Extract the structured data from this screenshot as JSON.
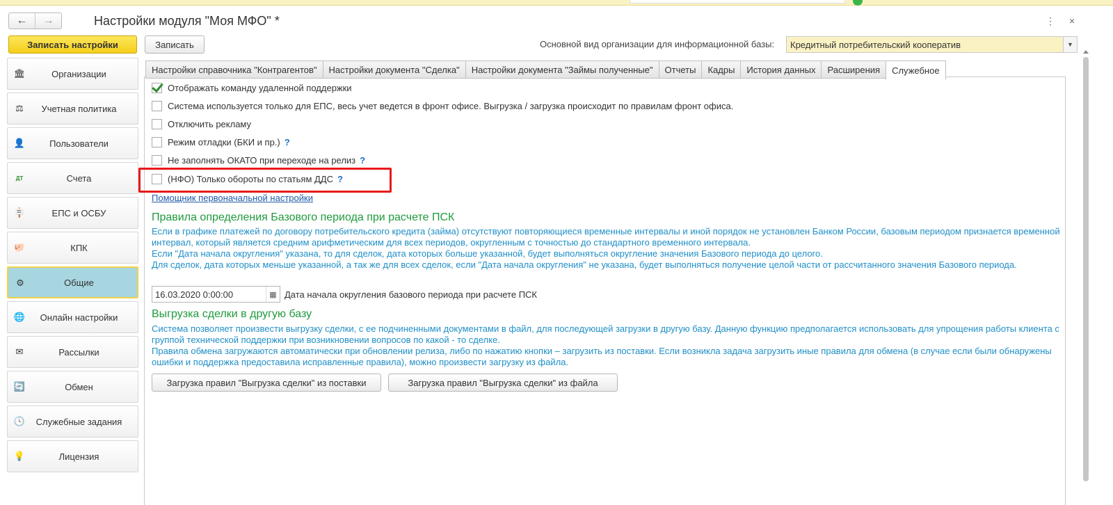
{
  "window": {
    "title": "Настройки модуля \"Моя МФО\" *",
    "back_icon": "←",
    "forward_icon": "→",
    "menu_icon": "⋮",
    "close_icon": "×"
  },
  "toolbar": {
    "save_settings_label": "Записать настройки",
    "save_label": "Записать",
    "org_type_label": "Основной вид организации для информационной базы:",
    "org_type_value": "Кредитный потребительский кооператив"
  },
  "sidebar": {
    "items": [
      {
        "label": "Организации",
        "icon": "🏛",
        "icon_name": "bank-icon"
      },
      {
        "label": "Учетная политика",
        "icon": "⚖",
        "icon_name": "scales-icon"
      },
      {
        "label": "Пользователи",
        "icon": "👤",
        "icon_name": "user-icon"
      },
      {
        "label": "Счета",
        "icon": "ДТ",
        "icon_name": "accounts-icon"
      },
      {
        "label": "ЕПС и ОСБУ",
        "icon": "🪧",
        "icon_name": "signpost-icon"
      },
      {
        "label": "КПК",
        "icon": "🐖",
        "icon_name": "piggy-bank-icon"
      },
      {
        "label": "Общие",
        "icon": "⚙",
        "icon_name": "gear-icon",
        "active": true
      },
      {
        "label": "Онлайн настройки",
        "icon": "🌐",
        "icon_name": "globe-icon"
      },
      {
        "label": "Рассылки",
        "icon": "✉",
        "icon_name": "envelope-icon"
      },
      {
        "label": "Обмен",
        "icon": "🔄",
        "icon_name": "exchange-icon"
      },
      {
        "label": "Служебные задания",
        "icon": "🕓",
        "icon_name": "clock-icon"
      },
      {
        "label": "Лицензия",
        "icon": "💡",
        "icon_name": "lightbulb-icon"
      }
    ]
  },
  "tabs": [
    {
      "label": "Настройки справочника \"Контрагентов\""
    },
    {
      "label": "Настройки документа \"Сделка\""
    },
    {
      "label": "Настройки документа \"Займы полученные\""
    },
    {
      "label": "Отчеты"
    },
    {
      "label": "Кадры"
    },
    {
      "label": "История данных"
    },
    {
      "label": "Расширения"
    },
    {
      "label": "Служебное",
      "active": true
    }
  ],
  "options": [
    {
      "label": "Отображать команду удаленной поддержки",
      "checked": true,
      "help": ""
    },
    {
      "label": "Система используется только для ЕПС, весь учет ведется в фронт офисе. Выгрузка / загрузка происходит по правилам фронт офиса.",
      "checked": false,
      "help": ""
    },
    {
      "label": "Отключить рекламу",
      "checked": false,
      "help": ""
    },
    {
      "label": "Режим отладки (БКИ и пр.)",
      "checked": false,
      "help": "?"
    },
    {
      "label": "Не заполнять ОКАТО при переходе на релиз",
      "checked": false,
      "help": "?"
    },
    {
      "label": "(НФО) Только обороты по статьям ДДС",
      "checked": false,
      "help": "?"
    }
  ],
  "wizard_link": "Помощник первоначальной настройки",
  "psk_section": {
    "title": "Правила определения Базового периода при расчете ПСК",
    "text_1": "Если в графике платежей по договору потребительского кредита (займа) отсутствуют повторяющиеся временные интервалы и иной порядок не установлен Банком России, базовым периодом признается временной интервал, который является средним арифметическим для всех периодов, округленным с точностью до стандартного временного интервала.",
    "text_2": "Если \"Дата начала округления\" указана, то для сделок, дата которых больше указанной, будет выполняться округление значения Базового периода до целого.",
    "text_3": "Для сделок, дата которых меньше указанной, а так же для всех сделок, если \"Дата начала округления\" не указана, будет выполняться получение целой части от рассчитанного значения Базового периода.",
    "date_value": "16.03.2020  0:00:00",
    "date_label": "Дата начала округления базового периода при расчете ПСК",
    "calendar_icon": "▦"
  },
  "export_section": {
    "title": "Выгрузка сделки в другую базу",
    "text_1": "Система позволяет произвести выгрузку сделки, с ее подчиненными документами в файл, для последующей загрузки в другую базу. Данную функцию предполагается использовать для упрощения работы клиента с группой технической поддержки при возникновении вопросов по какой - то сделке.",
    "text_2": "Правила обмена загружаются автоматически при обновлении релиза, либо по нажатию кнопки – загрузить из поставки. Если возникла задача загрузить иные правила для обмена (в случае если были обнаружены ошибки и поддержка предоставила исправленные правила), можно произвести загрузку из файла.",
    "btn_from_delivery": "Загрузка правил \"Выгрузка сделки\" из поставки",
    "btn_from_file": "Загрузка правил \"Выгрузка сделки\" из файла"
  },
  "colors": {
    "accent_yellow": "#f4cf1a",
    "active_item": "#a8d6e0",
    "section_title": "#1f9a3c",
    "info_text": "#1f8fc7",
    "highlight": "#e8191c"
  }
}
